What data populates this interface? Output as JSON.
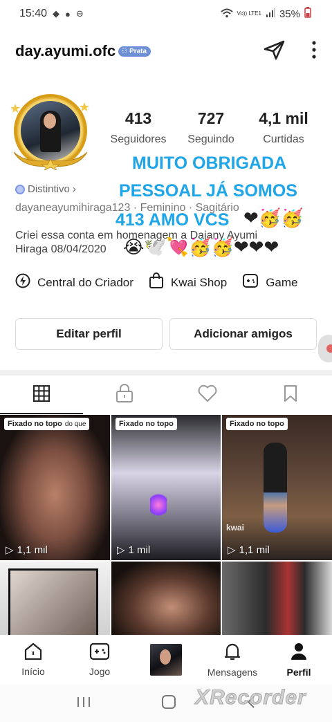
{
  "status_bar": {
    "time": "15:40",
    "battery": "35%",
    "carrier": "Vo)) LTE1"
  },
  "header": {
    "username": "day.ayumi.ofc",
    "badge": "Prata"
  },
  "stats": [
    {
      "value": "413",
      "label": "Seguidores"
    },
    {
      "value": "727",
      "label": "Seguindo"
    },
    {
      "value": "4,1 mil",
      "label": "Curtidas"
    }
  ],
  "overlay": {
    "line1": "MUITO OBRIGADA",
    "line2": "PESSOAL JÁ SOMOS",
    "line3": "413 AMO VCS",
    "emojis_line3": "❤🥳🥳",
    "emojis_bio": "😭🕊️💘🥳🥳❤❤❤"
  },
  "profile": {
    "distintivo": "Distintivo",
    "meta": "dayaneayumihiraga123 · Feminino · Sagitário",
    "bio_line1": "Criei essa conta em homenagem a Dajany Ayumi",
    "bio_line2": "Hiraga 08/04/2020"
  },
  "shortcuts": [
    {
      "label": "Central do Criador",
      "icon": "lightning-icon"
    },
    {
      "label": "Kwai Shop",
      "icon": "shopping-bag-icon"
    },
    {
      "label": "Game",
      "icon": "gamepad-icon"
    }
  ],
  "buttons": {
    "edit": "Editar perfil",
    "add": "Adicionar amigos"
  },
  "tabs": [
    "grid-icon",
    "lock-icon",
    "heart-icon",
    "bookmark-icon"
  ],
  "grid": [
    {
      "pinned": "Fixado no topo",
      "extra": "do que",
      "views": "1,1 mil"
    },
    {
      "pinned": "Fixado no topo",
      "extra": "",
      "views": "1 mil"
    },
    {
      "pinned": "Fixado no topo",
      "extra": "",
      "views": "1,1 mil",
      "watermark": "kwai"
    }
  ],
  "bottom_nav": [
    {
      "label": "Início",
      "icon": "home-icon"
    },
    {
      "label": "Jogo",
      "icon": "gamepad-icon"
    },
    {
      "label": "",
      "icon": "video-thumbnail"
    },
    {
      "label": "Mensagens",
      "icon": "bell-icon"
    },
    {
      "label": "Perfil",
      "icon": "person-icon"
    }
  ],
  "watermark": "XRecorder",
  "colors": {
    "accent_text": "#1fa6e8",
    "heart": "#e0202a",
    "badge": "#6c8fd6"
  }
}
